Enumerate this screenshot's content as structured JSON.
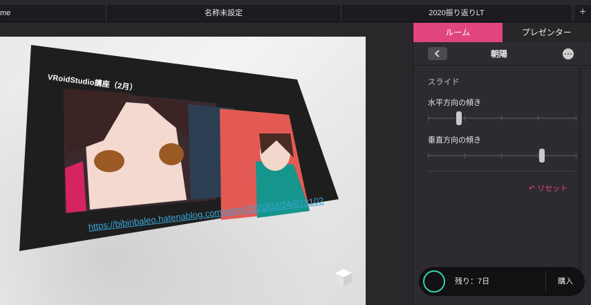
{
  "tabs": [
    "me",
    "名称未設定",
    "2020振り返りLT"
  ],
  "tab_add": "+",
  "slide": {
    "title": "VRoidStudio講座（2月）",
    "link": "https://bibinbaleo.hatenablog.com/entry/2020/02/24/073102"
  },
  "panel": {
    "tabs": [
      "ルーム",
      "プレゼンター"
    ],
    "header_title": "朝陽",
    "section_title": "スライド",
    "horizontal_label": "水平方向の傾き",
    "vertical_label": "垂直方向の傾き",
    "horizontal_value": 0.2,
    "vertical_value": 0.78,
    "reset_label": "リセット",
    "remaining": "残り：7日",
    "buy_label": "購入"
  },
  "colors": {
    "accent": "#e0457f",
    "ring": "#2fd6b0",
    "link": "#3aa6d8"
  }
}
